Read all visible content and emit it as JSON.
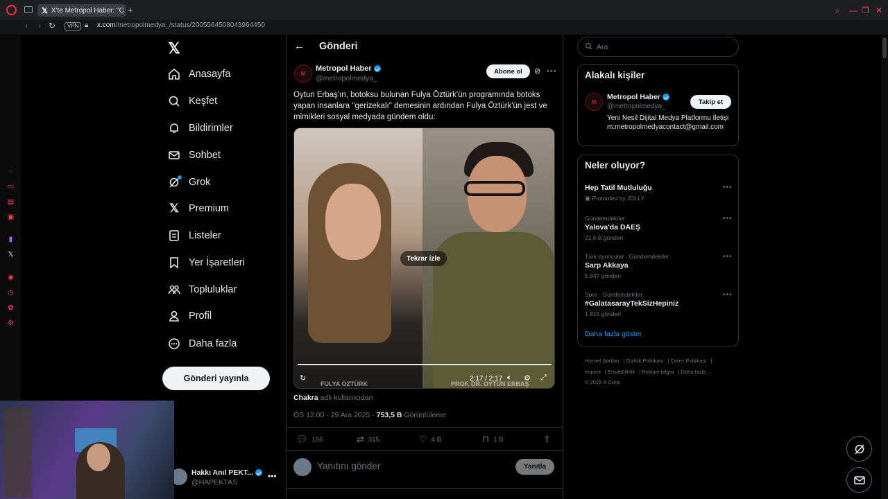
{
  "browser": {
    "tab_title": "X'te Metropol Haber: \"Oyt...",
    "new_tab": "+",
    "vpn": "VPN",
    "url_host": "x.com",
    "url_path": "/metropolmedya_/status/2005564508043964450"
  },
  "nav": {
    "items": [
      {
        "label": "Anasayfa",
        "icon": "home-icon"
      },
      {
        "label": "Keşfet",
        "icon": "search-icon"
      },
      {
        "label": "Bildirimler",
        "icon": "bell-icon"
      },
      {
        "label": "Sohbet",
        "icon": "mail-icon"
      },
      {
        "label": "Grok",
        "icon": "grok-icon"
      },
      {
        "label": "Premium",
        "icon": "x-icon"
      },
      {
        "label": "Listeler",
        "icon": "list-icon"
      },
      {
        "label": "Yer İşaretleri",
        "icon": "bookmark-icon"
      },
      {
        "label": "Topluluklar",
        "icon": "communities-icon"
      },
      {
        "label": "Profil",
        "icon": "person-icon"
      },
      {
        "label": "Daha fazla",
        "icon": "more-circle-icon"
      }
    ],
    "post_button": "Gönderi yayınla",
    "me": {
      "name": "Hakkı Anıl PEKT...",
      "handle": "@HAPEKTAS"
    }
  },
  "post": {
    "header_title": "Gönderi",
    "author": {
      "name": "Metropol Haber",
      "handle": "@metropolmedya_",
      "avatar_text": "M"
    },
    "subscribe": "Abone ol",
    "text": "Oytun Erbaş'ın, botoksu bulunan Fulya Öztürk'ün programında botoks yapan insanlara \"gerizekalı\" demesinin ardından Fulya Öztürk'ün jest ve mimikleri sosyal medyada gündem oldu:",
    "video": {
      "replay": "Tekrar izle",
      "time": "2:17 / 2:17",
      "progress": 1.0,
      "caption_left": "FULYA ÖZTÜRK",
      "caption_right": "PROF. DR. OYTUN ERBAŞ"
    },
    "from_user": "Chakra",
    "from_suffix": "adlı kullanıcıdan",
    "time": "ÖS 12:00 · 29 Ara 2025 · ",
    "views": "753,5 B",
    "views_label": "Görüntüleme",
    "actions": {
      "replies": "156",
      "reposts": "315",
      "likes": "4 B",
      "bookmarks": "1 B"
    },
    "reply_placeholder": "Yanıtını gönder",
    "reply_button": "Yanıtla"
  },
  "right": {
    "search_placeholder": "Ara",
    "related_title": "Alakalı kişiler",
    "related": {
      "name": "Metropol Haber",
      "handle": "@metropolmedya_",
      "follow": "Takip et",
      "bio": "Yeni Nesil Dijital Medya Platformu İletişim:metropolmedyacontact@gmail.com",
      "avatar_text": "M"
    },
    "trends_title": "Neler oluyor?",
    "trends": [
      {
        "meta": "",
        "name": "Hep Tatil Mutluluğu",
        "count": "Promoted by JOLLY"
      },
      {
        "meta": "Gündemdekiler",
        "name": "Yalova'da DAEŞ",
        "count": "21,6 B gönderi"
      },
      {
        "meta": "Türk oyuncular · Gündemdekiler",
        "name": "Sarp Akkaya",
        "count": "5.947 gönderi"
      },
      {
        "meta": "Spor · Gündemdekiler",
        "name": "#GalatasarayTekSizHepiniz",
        "count": "1.815 gönderi"
      }
    ],
    "show_more": "Daha fazla göster",
    "footer": [
      "Hizmet Şartları",
      "Gizlilik Politikası",
      "Çerez Politikası",
      "Imprint",
      "Erişilebilirlik",
      "Reklam bilgisi",
      "Daha fazla ...",
      "© 2025 X Corp."
    ]
  },
  "colors": {
    "accent": "#1d9bf0",
    "opera_red": "#ff2b4a",
    "background": "#000000"
  }
}
